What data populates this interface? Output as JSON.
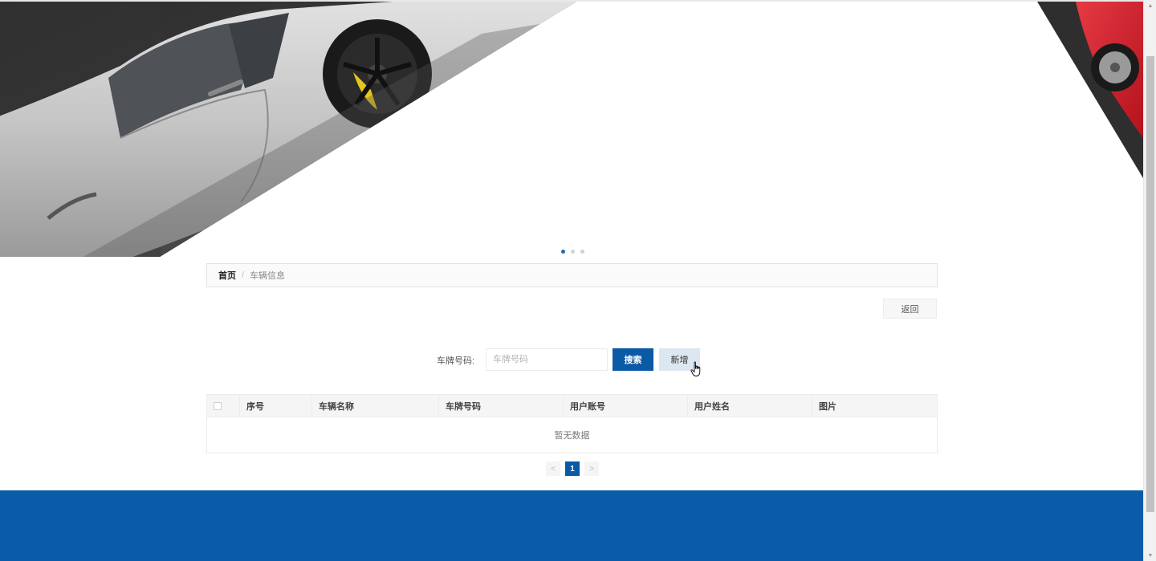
{
  "banner": {
    "dots": [
      {
        "active": true
      },
      {
        "active": false
      },
      {
        "active": false
      }
    ]
  },
  "breadcrumb": {
    "home": "首页",
    "separator": "/",
    "current": "车辆信息"
  },
  "actions": {
    "back_label": "返回"
  },
  "search": {
    "label": "车牌号码:",
    "placeholder": "车牌号码",
    "search_label": "搜索",
    "add_label": "新增"
  },
  "table": {
    "columns": [
      "序号",
      "车辆名称",
      "车牌号码",
      "用户账号",
      "用户姓名",
      "图片"
    ],
    "empty_text": "暂无数据"
  },
  "pagination": {
    "prev": "<",
    "current": "1",
    "next": ">"
  },
  "colors": {
    "primary": "#0a5aa5",
    "footer": "#0b5ca8",
    "accent_car": "#d42a35"
  }
}
